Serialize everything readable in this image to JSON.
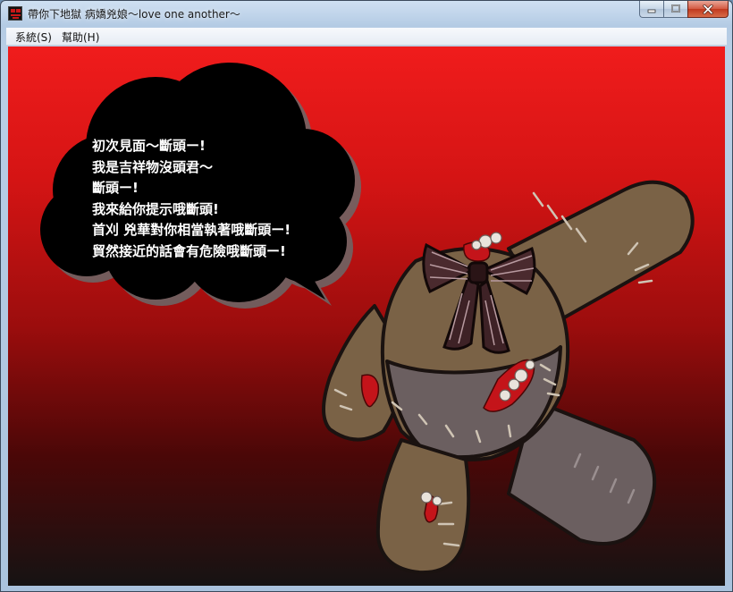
{
  "window": {
    "title": "帶你下地獄 病嬌兇娘～love one another～",
    "minimize_glyph": "–",
    "maximize_glyph": "□",
    "close_glyph": "✕"
  },
  "menu": {
    "items": [
      {
        "label": "系統(S)"
      },
      {
        "label": "幫助(H)"
      }
    ]
  },
  "dialog": {
    "lines": [
      "初次見面～斷頭ー!",
      "我是吉祥物沒頭君～",
      "斷頭ー!",
      "我來給你提示哦斷頭!",
      "首刈 兇華對你相當執著哦斷頭ー!",
      "貿然接近的話會有危險哦斷頭ー!"
    ]
  },
  "icons": {
    "app": "app-icon",
    "minimize": "minimize-icon",
    "maximize": "maximize-icon",
    "close": "close-icon"
  },
  "colors": {
    "background_top": "#f01c1c",
    "background_bottom": "#161313",
    "speech_bubble": "#000000",
    "doll_fabric": "#7a6246",
    "doll_grey": "#6b5f60",
    "blood": "#c4141a"
  }
}
